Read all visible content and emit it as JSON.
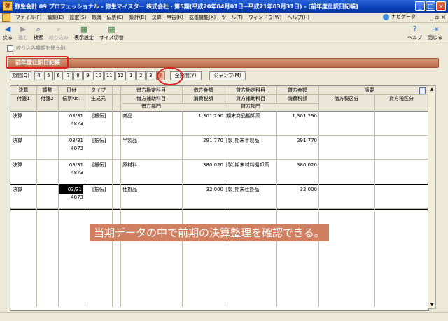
{
  "window": {
    "title": "弥生会計 09 プロフェッショナル - 弥生マイスター 株式会社・第5期(平成20年04月01日~平成21年03月31日) - [前年度仕訳日記帳]"
  },
  "menu": {
    "items": [
      "ファイル(F)",
      "編集(E)",
      "設定(S)",
      "帳簿・伝票(C)",
      "集計(B)",
      "決算・申告(K)",
      "拡張機能(X)",
      "ツール(T)",
      "ウィンドウ(W)",
      "ヘルプ(H)"
    ],
    "navi": "ナビゲータ"
  },
  "toolbar": {
    "back": "戻る",
    "forward": "進む",
    "search": "検索",
    "filter": "絞り込み",
    "display": "表示設定",
    "size": "サイズ切替",
    "help": "ヘルプ",
    "close": "閉じる"
  },
  "filter_option": "絞り込み機能を使う(I)",
  "page_title": "前年度仕訳日記帳",
  "period": {
    "label": "期間(Q)",
    "months": [
      "4",
      "5",
      "6",
      "7",
      "8",
      "9",
      "10",
      "11",
      "12",
      "1",
      "2",
      "3",
      "決"
    ],
    "all": "全期間(Y)",
    "jump": "ジャンプ(M)"
  },
  "table": {
    "headers_r1": [
      "決算",
      "調整",
      "日付",
      "タイプ",
      "借方勘定科目",
      "借方金額",
      "貸方勘定科目",
      "貸方金額",
      "摘要"
    ],
    "headers_r2": [
      "付箋1",
      "付箋2",
      "伝票No.",
      "生成元",
      "借方補助科目",
      "消費税額",
      "貸方補助科目",
      "消費税額",
      "借方税区分",
      "貸方税区分"
    ],
    "headers_r3": [
      "借方部門",
      "貸方部門"
    ],
    "rows": [
      {
        "kessan": "決算",
        "date": "03/31",
        "no": "4873",
        "type": "[振伝]",
        "debit": "商品",
        "debit_amt": "1,301,290",
        "credit": "期末商品棚卸高",
        "credit_amt": "1,301,290"
      },
      {
        "kessan": "決算",
        "date": "03/31",
        "no": "4873",
        "type": "[振伝]",
        "debit": "半製品",
        "debit_amt": "291,770",
        "credit": "[製]期末半製品",
        "credit_amt": "291,770"
      },
      {
        "kessan": "決算",
        "date": "03/31",
        "no": "4873",
        "type": "[振伝]",
        "debit": "原材料",
        "debit_amt": "380,020",
        "credit": "[製]期末材料棚卸高",
        "credit_amt": "380,020"
      },
      {
        "kessan": "決算",
        "date": "03/31",
        "no": "4873",
        "type": "[振伝]",
        "debit": "仕掛品",
        "debit_amt": "32,000",
        "credit": "[製]期末仕掛品",
        "credit_amt": "32,000"
      }
    ]
  },
  "annotation": "当期データの中で前期の決算整理を確認できる。",
  "colors": {
    "title_bar": "#0a3fb8",
    "banner": "#c07a58",
    "highlight": "#e02020"
  }
}
